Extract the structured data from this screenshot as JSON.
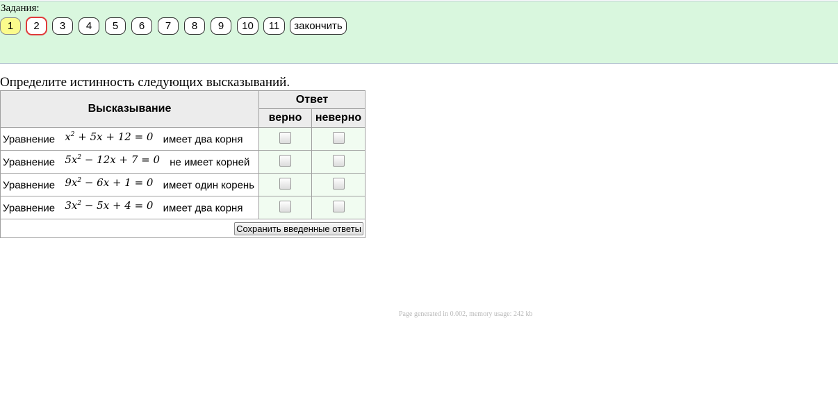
{
  "header": {
    "tasks_label": "Задания:",
    "tasks": [
      "1",
      "2",
      "3",
      "4",
      "5",
      "6",
      "7",
      "8",
      "9",
      "10",
      "11"
    ],
    "current_task": "1",
    "selected_task": "2",
    "finish_label": "закончить"
  },
  "prompt": "Определите истинность следующих высказываний.",
  "table": {
    "col_statement": "Высказывание",
    "col_answer": "Ответ",
    "col_true": "верно",
    "col_false": "неверно",
    "rows": [
      {
        "word": "Уравнение",
        "eq_a": "x",
        "eq_rest": " + 5x + 12 = 0",
        "tail": "имеет два корня"
      },
      {
        "word": "Уравнение",
        "eq_a": "5x",
        "eq_rest": " − 12x + 7 = 0",
        "tail": "не имеет корней"
      },
      {
        "word": "Уравнение",
        "eq_a": "9x",
        "eq_rest": " − 6x + 1 = 0",
        "tail": "имеет один корень"
      },
      {
        "word": "Уравнение",
        "eq_a": "3x",
        "eq_rest": " − 5x + 4 = 0",
        "tail": "имеет два корня"
      }
    ],
    "exponent": "2",
    "save_label": "Сохранить введенные ответы"
  },
  "footer": "Page generated in 0.002, memory usage: 242 kb"
}
